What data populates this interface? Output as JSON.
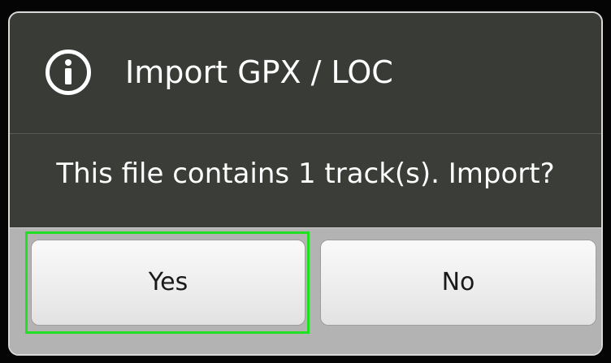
{
  "dialog": {
    "title": "Import GPX / LOC",
    "icon": "info-icon",
    "message": "This file contains 1 track(s). Import?",
    "buttons": {
      "yes_label": "Yes",
      "no_label": "No"
    },
    "focused_button": "Yes"
  },
  "colors": {
    "dialog_background": "#3a3d38",
    "button_bar": "#b3b3b3",
    "focus_highlight": "#21e021",
    "text": "#ffffff"
  }
}
